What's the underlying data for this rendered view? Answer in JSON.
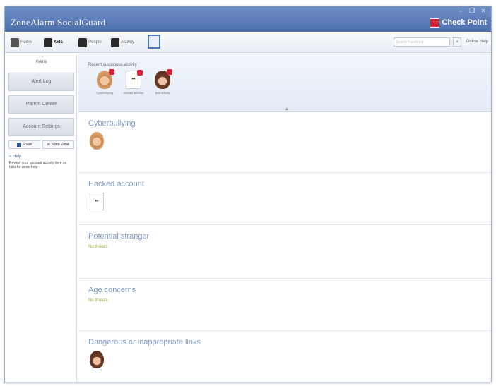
{
  "window": {
    "title": "ZoneAlarm SocialGuard",
    "brand": "Check Point",
    "controls": [
      "–",
      "❐",
      "×"
    ]
  },
  "toolbar": {
    "tools": [
      {
        "label": "Home",
        "icon": "music-note-icon"
      },
      {
        "label": "Kids",
        "icon": "kid-icon"
      },
      {
        "label": "People",
        "icon": "people-icon"
      },
      {
        "label": "Activity",
        "icon": "activity-icon"
      }
    ],
    "book_icon": "book-icon",
    "search_placeholder": "Search Facebook",
    "search_icon": "search-icon",
    "help_link": "Online Help"
  },
  "sidebar": {
    "top_label": "Home",
    "buttons": [
      "Alert Log",
      "Parent Center",
      "Account Settings"
    ],
    "share": [
      {
        "label": "Share",
        "icon": "facebook-icon"
      },
      {
        "label": "Send Email",
        "icon": "mail-icon"
      }
    ],
    "help": {
      "title": "Help",
      "text": "Review your account activity here on tabs for more help"
    }
  },
  "alerts": {
    "title": "Recent suspicious activity",
    "items": [
      {
        "label": "Cyberbullying",
        "icon": "child-avatar-icon"
      },
      {
        "label": "Hacked account",
        "icon": "hidden-account-icon"
      },
      {
        "label": "Bad activity",
        "icon": "child-avatar-icon"
      }
    ]
  },
  "sections": [
    {
      "title": "Cyberbullying",
      "status": "",
      "icon": "child-avatar-icon"
    },
    {
      "title": "Hacked account",
      "status": "",
      "icon": "hidden-account-icon"
    },
    {
      "title": "Potential stranger",
      "status": "No threats",
      "icon": ""
    },
    {
      "title": "Age concerns",
      "status": "No threats",
      "icon": ""
    },
    {
      "title": "Dangerous or inappropriate links",
      "status": "",
      "icon": "child-avatar-icon"
    }
  ],
  "colors": {
    "titlebar": "#5a7bb8",
    "accent_red": "#d6243a",
    "section_title": "#7f9bc8",
    "ok_status": "#9fb23a"
  }
}
